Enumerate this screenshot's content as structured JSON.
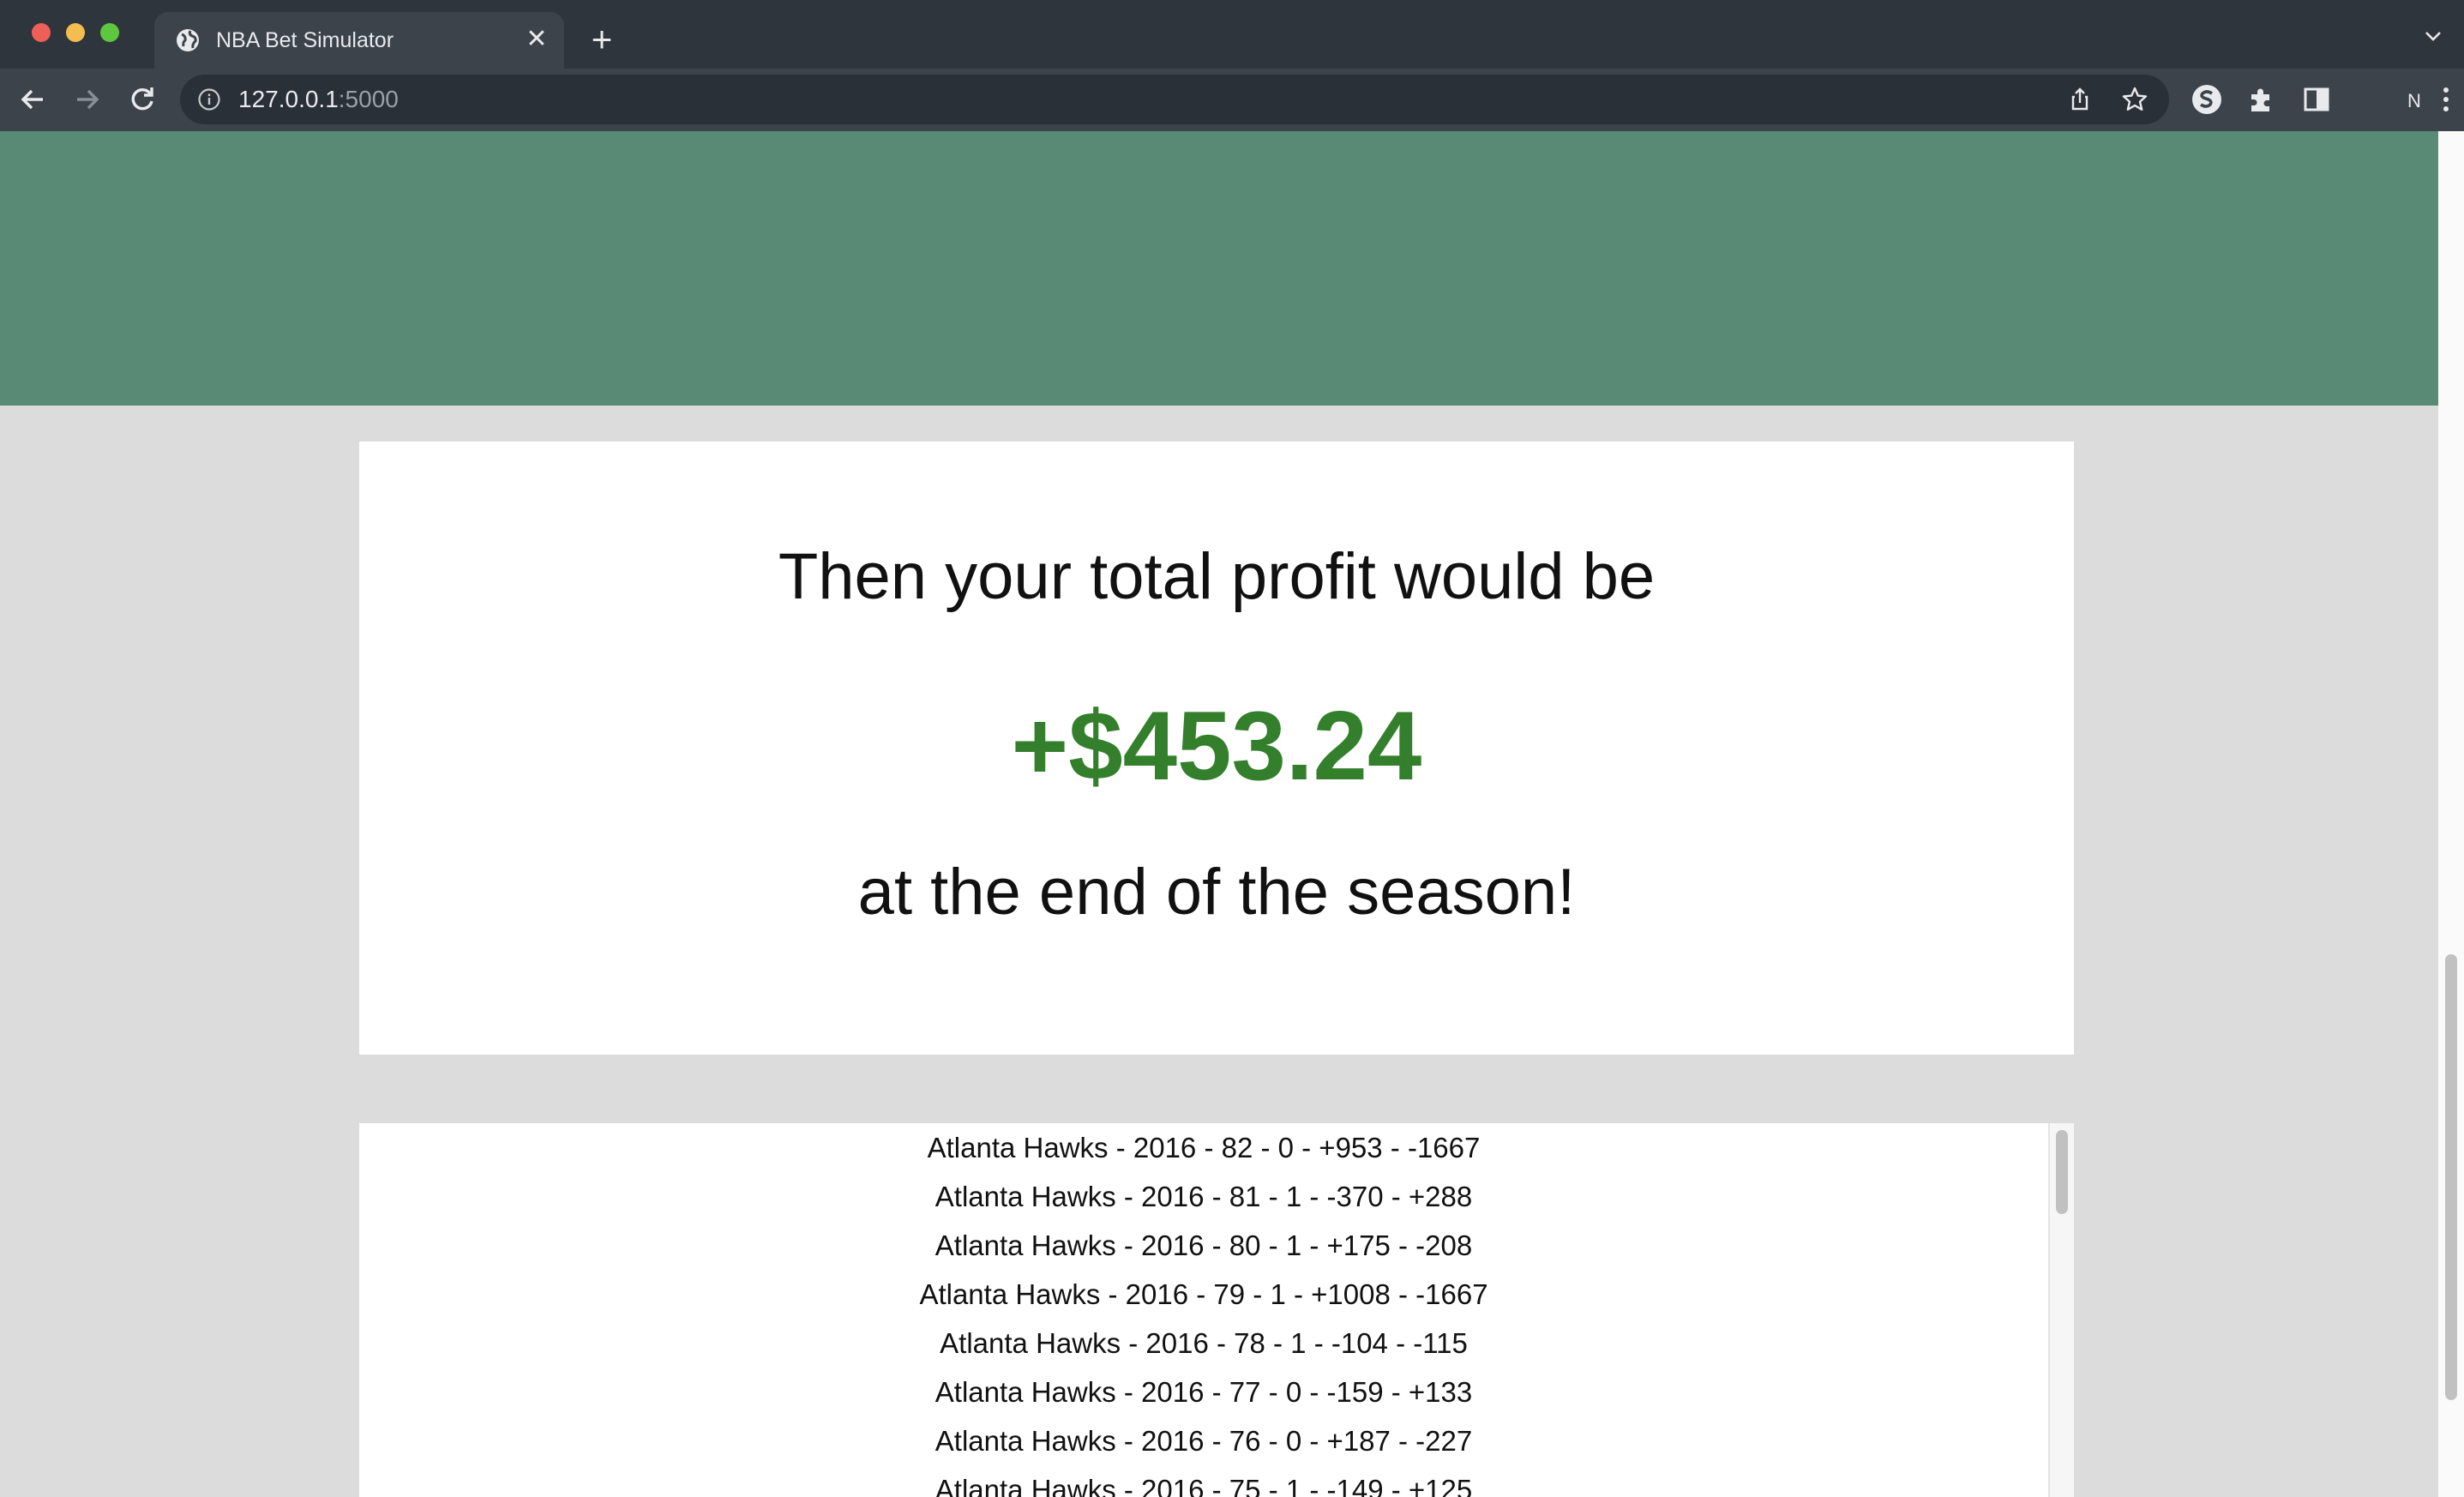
{
  "browser": {
    "tab_title": "NBA Bet Simulator",
    "close_glyph": "✕",
    "new_tab_glyph": "+",
    "url_host": "127.0.0.1",
    "url_port": ":5000",
    "profile_initial": "N"
  },
  "result": {
    "line1": "Then your total profit would be",
    "profit": "+$453.24",
    "line3": "at the end of the season!",
    "profit_color": "#337f2b"
  },
  "games": [
    "Atlanta Hawks - 2016 - 82 - 0 - +953 - -1667",
    "Atlanta Hawks - 2016 - 81 - 1 - -370 - +288",
    "Atlanta Hawks - 2016 - 80 - 1 - +175 - -208",
    "Atlanta Hawks - 2016 - 79 - 1 - +1008 - -1667",
    "Atlanta Hawks - 2016 - 78 - 1 - -104 - -115",
    "Atlanta Hawks - 2016 - 77 - 0 - -159 - +133",
    "Atlanta Hawks - 2016 - 76 - 0 - +187 - -227",
    "Atlanta Hawks - 2016 - 75 - 1 - -149 - +125"
  ],
  "colors": {
    "hero": "#598a75",
    "page_bg": "#dcdcdc",
    "chrome_dark": "#2f353d"
  }
}
